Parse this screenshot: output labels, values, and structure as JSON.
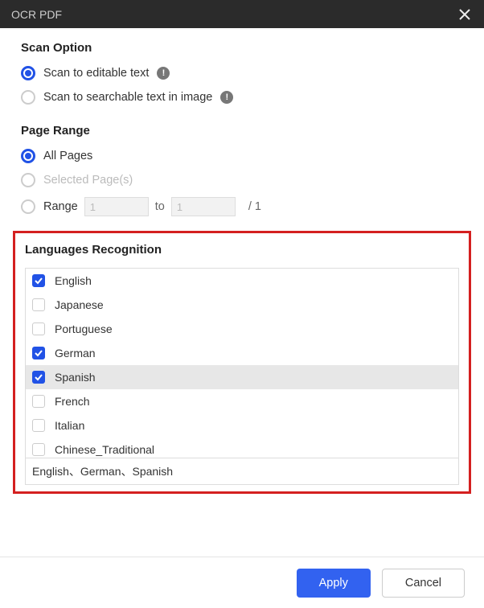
{
  "titlebar": {
    "title": "OCR PDF"
  },
  "scan": {
    "title": "Scan Option",
    "options": [
      {
        "label": "Scan to editable text",
        "selected": true,
        "info": true
      },
      {
        "label": "Scan to searchable text in image",
        "selected": false,
        "info": true
      }
    ]
  },
  "pagerange": {
    "title": "Page Range",
    "all_label": "All Pages",
    "selected_label": "Selected Page(s)",
    "range_label": "Range",
    "from_value": "1",
    "to_label": "to",
    "to_value": "1",
    "total": "/ 1"
  },
  "languages": {
    "title": "Languages Recognition",
    "items": [
      {
        "label": "English",
        "checked": true,
        "highlight": false
      },
      {
        "label": "Japanese",
        "checked": false,
        "highlight": false
      },
      {
        "label": "Portuguese",
        "checked": false,
        "highlight": false
      },
      {
        "label": "German",
        "checked": true,
        "highlight": false
      },
      {
        "label": "Spanish",
        "checked": true,
        "highlight": true
      },
      {
        "label": "French",
        "checked": false,
        "highlight": false
      },
      {
        "label": "Italian",
        "checked": false,
        "highlight": false
      },
      {
        "label": "Chinese_Traditional",
        "checked": false,
        "highlight": false
      }
    ],
    "summary": "English、German、Spanish"
  },
  "footer": {
    "apply": "Apply",
    "cancel": "Cancel"
  }
}
